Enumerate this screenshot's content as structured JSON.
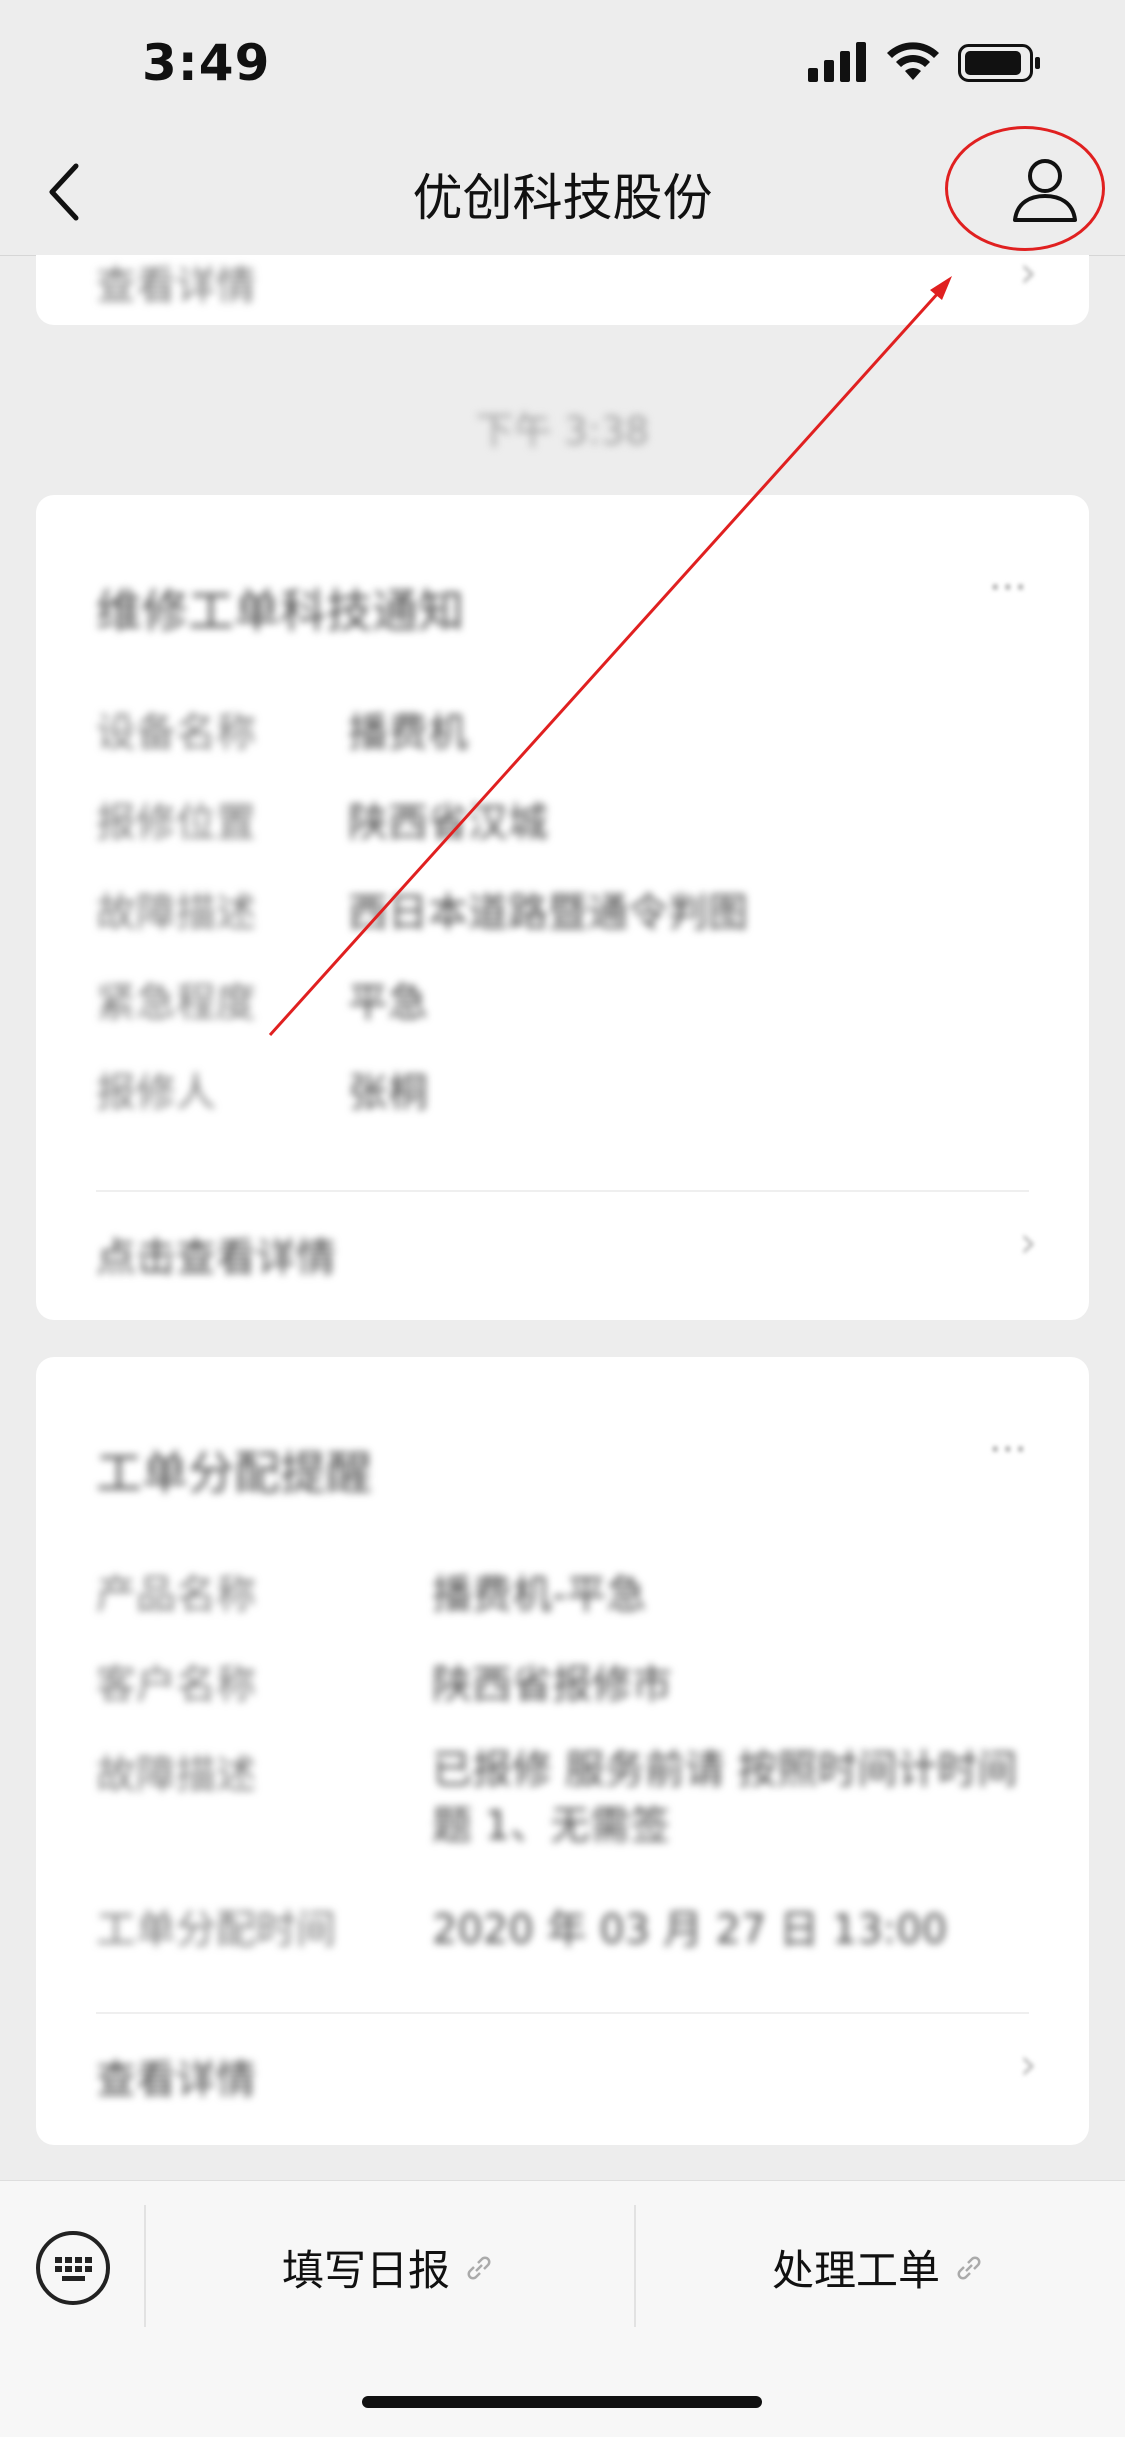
{
  "status_bar": {
    "time": "3:49"
  },
  "nav": {
    "title": "优创科技股份"
  },
  "top_card": {
    "label": "查看详情"
  },
  "timestamp": "下午 3:38",
  "card1": {
    "title": "维修工单科技通知",
    "rows": [
      {
        "label": "设备名称",
        "value": "播费机"
      },
      {
        "label": "报修位置",
        "value": "陕西省汉城"
      },
      {
        "label": "故障描述",
        "value": "西日本道路暨通令判图"
      },
      {
        "label": "紧急程度",
        "value": "平急"
      },
      {
        "label": "报修人",
        "value": "张桐"
      }
    ],
    "footer": "点击查看详情"
  },
  "card2": {
    "title": "工单分配提醒",
    "rows": [
      {
        "label": "产品名称",
        "value": "播费机-平急"
      },
      {
        "label": "客户名称",
        "value": "陕西省报修市"
      },
      {
        "label": "故障描述",
        "value": "已报修 服务前请 按照时间计时间题 1、无需签"
      },
      {
        "label": "工单分配时间",
        "value": "2020 年 03 月 27 日 13:00"
      }
    ],
    "footer": "查看详情"
  },
  "bottom_bar": {
    "menu1": "填写日报",
    "menu2": "处理工单"
  },
  "annotation": {
    "color": "#e02020"
  }
}
